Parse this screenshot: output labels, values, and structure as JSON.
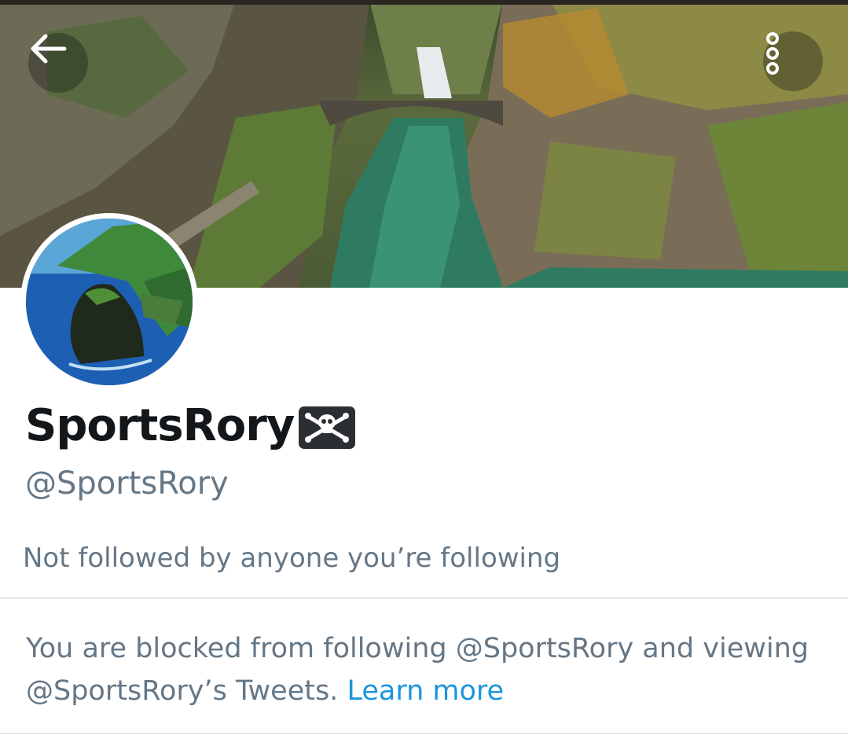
{
  "profile": {
    "display_name": "SportsRory",
    "name_emoji": "skull-and-crossbones",
    "handle": "@SportsRory",
    "social_context": "Not followed by anyone you’re following",
    "blocked_message": "You are blocked from following @SportsRory and viewing @SportsRory’s Tweets.",
    "learn_more": "Learn more"
  },
  "header": {
    "back_icon": "back-arrow-icon",
    "more_icon": "more-vertical-icon"
  },
  "colors": {
    "text_primary": "#14171a",
    "text_secondary": "#657786",
    "link": "#1b95e0",
    "divider": "#e1e8ed"
  }
}
